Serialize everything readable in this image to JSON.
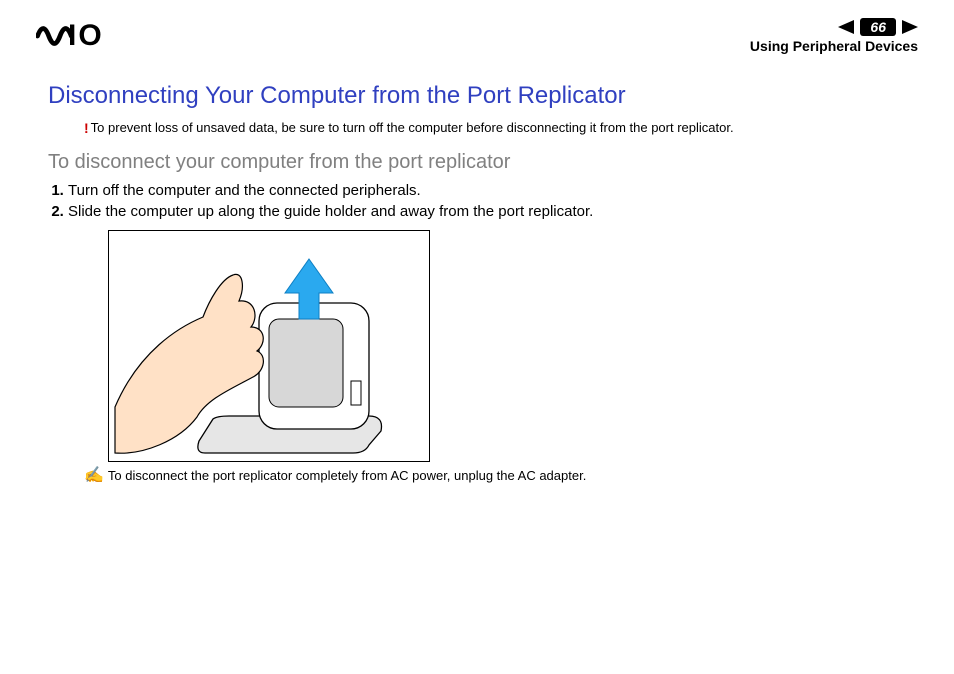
{
  "header": {
    "page_number": "66",
    "section": "Using Peripheral Devices"
  },
  "body": {
    "title": "Disconnecting Your Computer from the Port Replicator",
    "warning": "To prevent loss of unsaved data, be sure to turn off the computer before disconnecting it from the port replicator.",
    "subtitle": "To disconnect your computer from the port replicator",
    "steps": [
      "Turn off the computer and the connected peripherals.",
      "Slide the computer up along the guide holder and away from the port replicator."
    ],
    "note": "To disconnect the port replicator completely from AC power, unplug the AC adapter."
  },
  "icons": {
    "brand_text": "IO",
    "warning_glyph": "!",
    "note_glyph": "✍"
  }
}
